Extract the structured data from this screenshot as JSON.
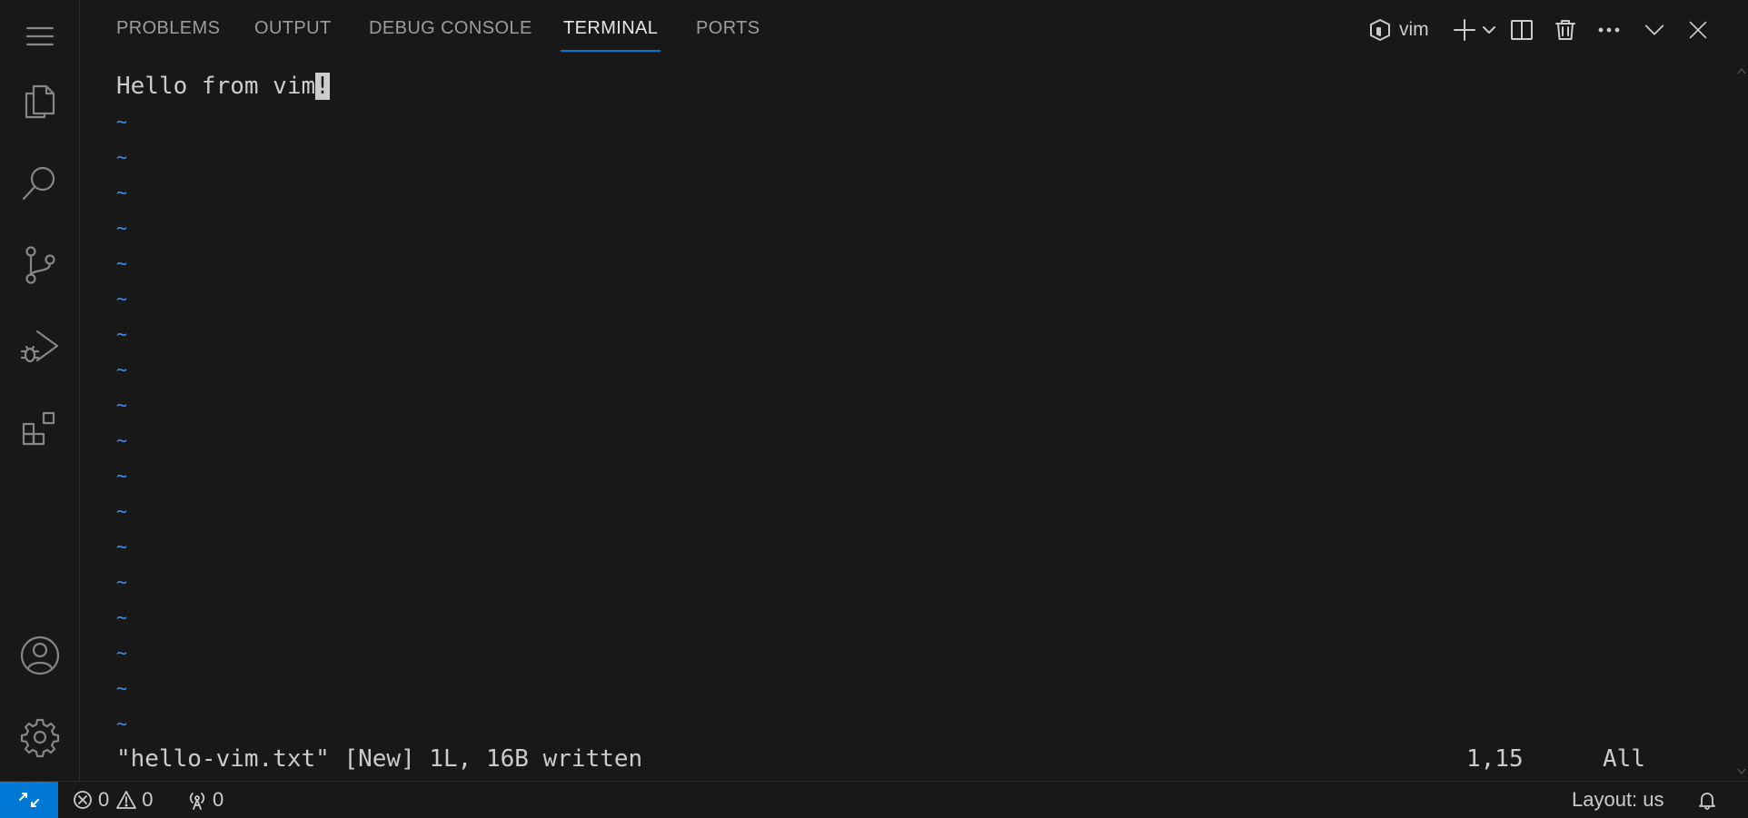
{
  "panel": {
    "tabs": [
      {
        "label": "PROBLEMS"
      },
      {
        "label": "OUTPUT"
      },
      {
        "label": "DEBUG CONSOLE"
      },
      {
        "label": "TERMINAL"
      },
      {
        "label": "PORTS"
      }
    ],
    "active_tab": "TERMINAL",
    "terminal_name": "vim"
  },
  "terminal": {
    "first_line_text": "Hello from vim",
    "cursor_char": "!",
    "tilde": "~",
    "status_message": "\"hello-vim.txt\" [New] 1L, 16B written",
    "ruler": "1,15",
    "scroll_position": "All"
  },
  "statusbar": {
    "errors": "0",
    "warnings": "0",
    "ports": "0",
    "layout": "Layout: us"
  },
  "colors": {
    "accent": "#0078d4",
    "tilde": "#3b8eea",
    "background": "#181818"
  }
}
